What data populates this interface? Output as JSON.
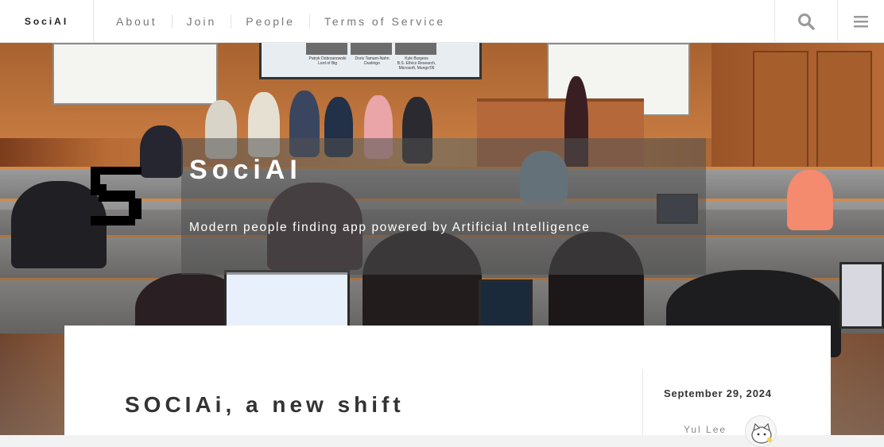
{
  "nav": {
    "brand": "SociAI",
    "items": [
      {
        "label": "About"
      },
      {
        "label": "Join"
      },
      {
        "label": "People"
      },
      {
        "label": "Terms of Service"
      }
    ],
    "search_icon": "search-icon",
    "menu_icon": "hamburger-menu-icon"
  },
  "hero": {
    "title": "SociAI",
    "subtitle": "Modern people finding app powered by Artificial Intelligence",
    "screen_captions": [
      {
        "name": "Patryk Dobrzanowski",
        "role": "Lord of Big"
      },
      {
        "name": "Doris Tamam-Nahn",
        "role": "Duolingo"
      },
      {
        "name": "Kyle Burgess",
        "role": "B.S. Ethics Research, Microsoft, Mungo'06"
      }
    ]
  },
  "post": {
    "title": "SOCIAi, a new shift",
    "date": "September 29, 2024",
    "author": "Yul Lee"
  },
  "colors": {
    "nav_bg": "#ffffff",
    "nav_text": "#777777",
    "title_text": "#333333",
    "hero_overlay": "#505050"
  }
}
